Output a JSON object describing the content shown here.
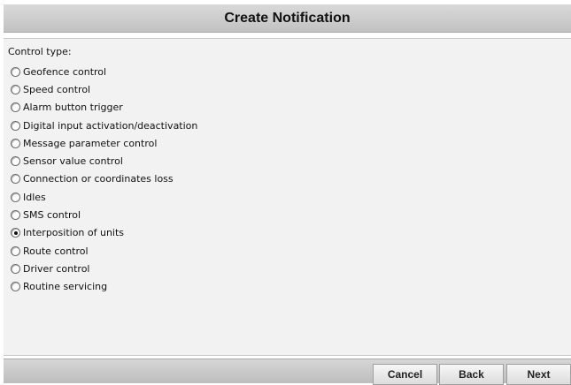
{
  "dialog": {
    "title": "Create Notification"
  },
  "control_type": {
    "label": "Control type:",
    "options": [
      {
        "label": "Geofence control",
        "checked": false
      },
      {
        "label": "Speed control",
        "checked": false
      },
      {
        "label": "Alarm button trigger",
        "checked": false
      },
      {
        "label": "Digital input activation/deactivation",
        "checked": false
      },
      {
        "label": "Message parameter control",
        "checked": false
      },
      {
        "label": "Sensor value control",
        "checked": false
      },
      {
        "label": "Connection or coordinates loss",
        "checked": false
      },
      {
        "label": "Idles",
        "checked": false
      },
      {
        "label": "SMS control",
        "checked": false
      },
      {
        "label": "Interposition of units",
        "checked": true
      },
      {
        "label": "Route control",
        "checked": false
      },
      {
        "label": "Driver control",
        "checked": false
      },
      {
        "label": "Routine servicing",
        "checked": false
      }
    ]
  },
  "footer": {
    "cancel_label": "Cancel",
    "back_label": "Back",
    "next_label": "Next"
  }
}
